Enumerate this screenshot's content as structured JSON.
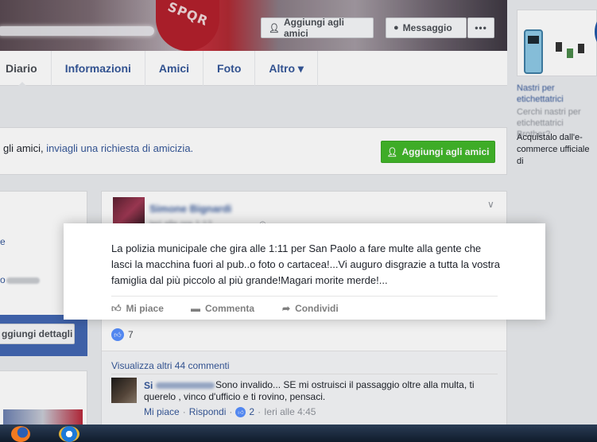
{
  "cover": {
    "add_friend_label": "Aggiungi agli amici",
    "message_label": "Messaggio",
    "more_label": "•••",
    "crest_text": "SPQR"
  },
  "tabs": [
    {
      "label": "Diario"
    },
    {
      "label": "Informazioni"
    },
    {
      "label": "Amici"
    },
    {
      "label": "Foto"
    },
    {
      "label": "Altro ▾"
    }
  ],
  "friend_request": {
    "text_prefix": "gli amici, ",
    "link_text": "inviagli una richiesta di amicizia.",
    "button_label": "Aggiungi agli amici"
  },
  "left": {
    "details_button": "ggiungi dettagli",
    "dot_a": "e",
    "dot_b": "o"
  },
  "ad": {
    "title": "Nastri per etichettatrici",
    "subtitle": "Cerchi nastri per etichettatrici Brother?",
    "text": "Acquistalo dall'e-commerce ufficiale di"
  },
  "post": {
    "author": "Simone Bignardi",
    "timestamp": "Ieri alle ore 1:12",
    "text": "La polizia municipale che gira alle 1:11 per San Paolo a fare multe alla gente che lasci la macchina fuori al pub..o foto o cartacea!...Vi auguro disgrazie a tutta la vostra famiglia dal più piccolo al più grande!Magari morite merde!...",
    "actions": {
      "like": "Mi piace",
      "comment": "Commenta",
      "share": "Condividi"
    },
    "like_count": "7"
  },
  "comments": {
    "view_more": "Visualizza altri 44 commenti",
    "items": [
      {
        "author_initial": "Si",
        "text": "Sono invalido... SE mi ostruisci il passaggio oltre alla multa, ti querelo , vinco d'ufficio e ti rovino, pensaci.",
        "like_link": "Mi piace",
        "reply_link": "Rispondi",
        "sep": "·",
        "likes": "2",
        "time": "Ieri alle 4:45"
      }
    ]
  },
  "icons": {
    "add_friend": "person-plus-icon",
    "message": "messenger-icon",
    "like": "thumbs-up-icon",
    "comment": "speech-bubble-icon",
    "share": "share-arrow-icon",
    "globe": "globe-icon",
    "chevron": "chevron-down-icon"
  },
  "colors": {
    "link": "#365899",
    "green_button": "#42b72a",
    "page_bg": "#e9ebee",
    "like_badge": "#5890ff"
  }
}
